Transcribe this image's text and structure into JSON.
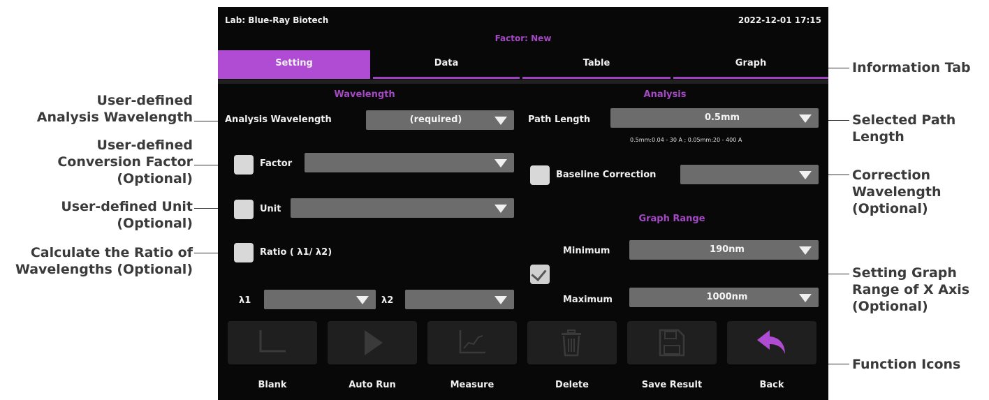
{
  "header": {
    "lab": "Lab: Blue-Ray Biotech",
    "datetime": "2022-12-01 17:15",
    "factor": "Factor: New"
  },
  "tabs": [
    {
      "label": "Setting",
      "active": true
    },
    {
      "label": "Data",
      "active": false
    },
    {
      "label": "Table",
      "active": false
    },
    {
      "label": "Graph",
      "active": false
    }
  ],
  "wavelength": {
    "title": "Wavelength",
    "analysis_label": "Analysis Wavelength",
    "analysis_value": "(required)",
    "factor_label": "Factor",
    "factor_value": "",
    "unit_label": "Unit",
    "unit_value": "",
    "ratio_label": "Ratio ( λ1/ λ2)",
    "l1_label": "λ1",
    "l2_label": "λ2"
  },
  "analysis": {
    "title": "Analysis",
    "path_label": "Path Length",
    "path_value": "0.5mm",
    "path_hint": "0.5mm:0.04 - 30 A ; 0.05mm:20 - 400 A",
    "baseline_label": "Baseline Correction",
    "graph_range_title": "Graph Range",
    "minimum_label": "Minimum",
    "minimum_value": "190nm",
    "maximum_label": "Maximum",
    "maximum_value": "1000nm",
    "graph_range_checked": true
  },
  "functions": [
    {
      "label": "Blank",
      "icon": "blank-icon"
    },
    {
      "label": "Auto Run",
      "icon": "play-icon"
    },
    {
      "label": "Measure",
      "icon": "measure-chart-icon"
    },
    {
      "label": "Delete",
      "icon": "trash-icon"
    },
    {
      "label": "Save Result",
      "icon": "save-icon"
    },
    {
      "label": "Back",
      "icon": "back-arrow-icon"
    }
  ],
  "annotations": {
    "left": [
      "User-defined\nAnalysis Wavelength",
      "User-defined\nConversion Factor\n(Optional)",
      "User-defined Unit\n(Optional)",
      "Calculate the Ratio of\nWavelengths (Optional)"
    ],
    "right": [
      "Information Tab",
      "Selected Path\nLength",
      "Correction\nWavelength\n(Optional)",
      "Setting Graph\nRange of X Axis\n(Optional)",
      "Function Icons"
    ]
  },
  "colors": {
    "accent": "#b04bd3",
    "accent_text": "#a548c4",
    "screen_bg": "#080808",
    "field_bg": "#6c6c6c",
    "button_bg": "#1f1f1f",
    "back_arrow": "#b04bd3"
  }
}
